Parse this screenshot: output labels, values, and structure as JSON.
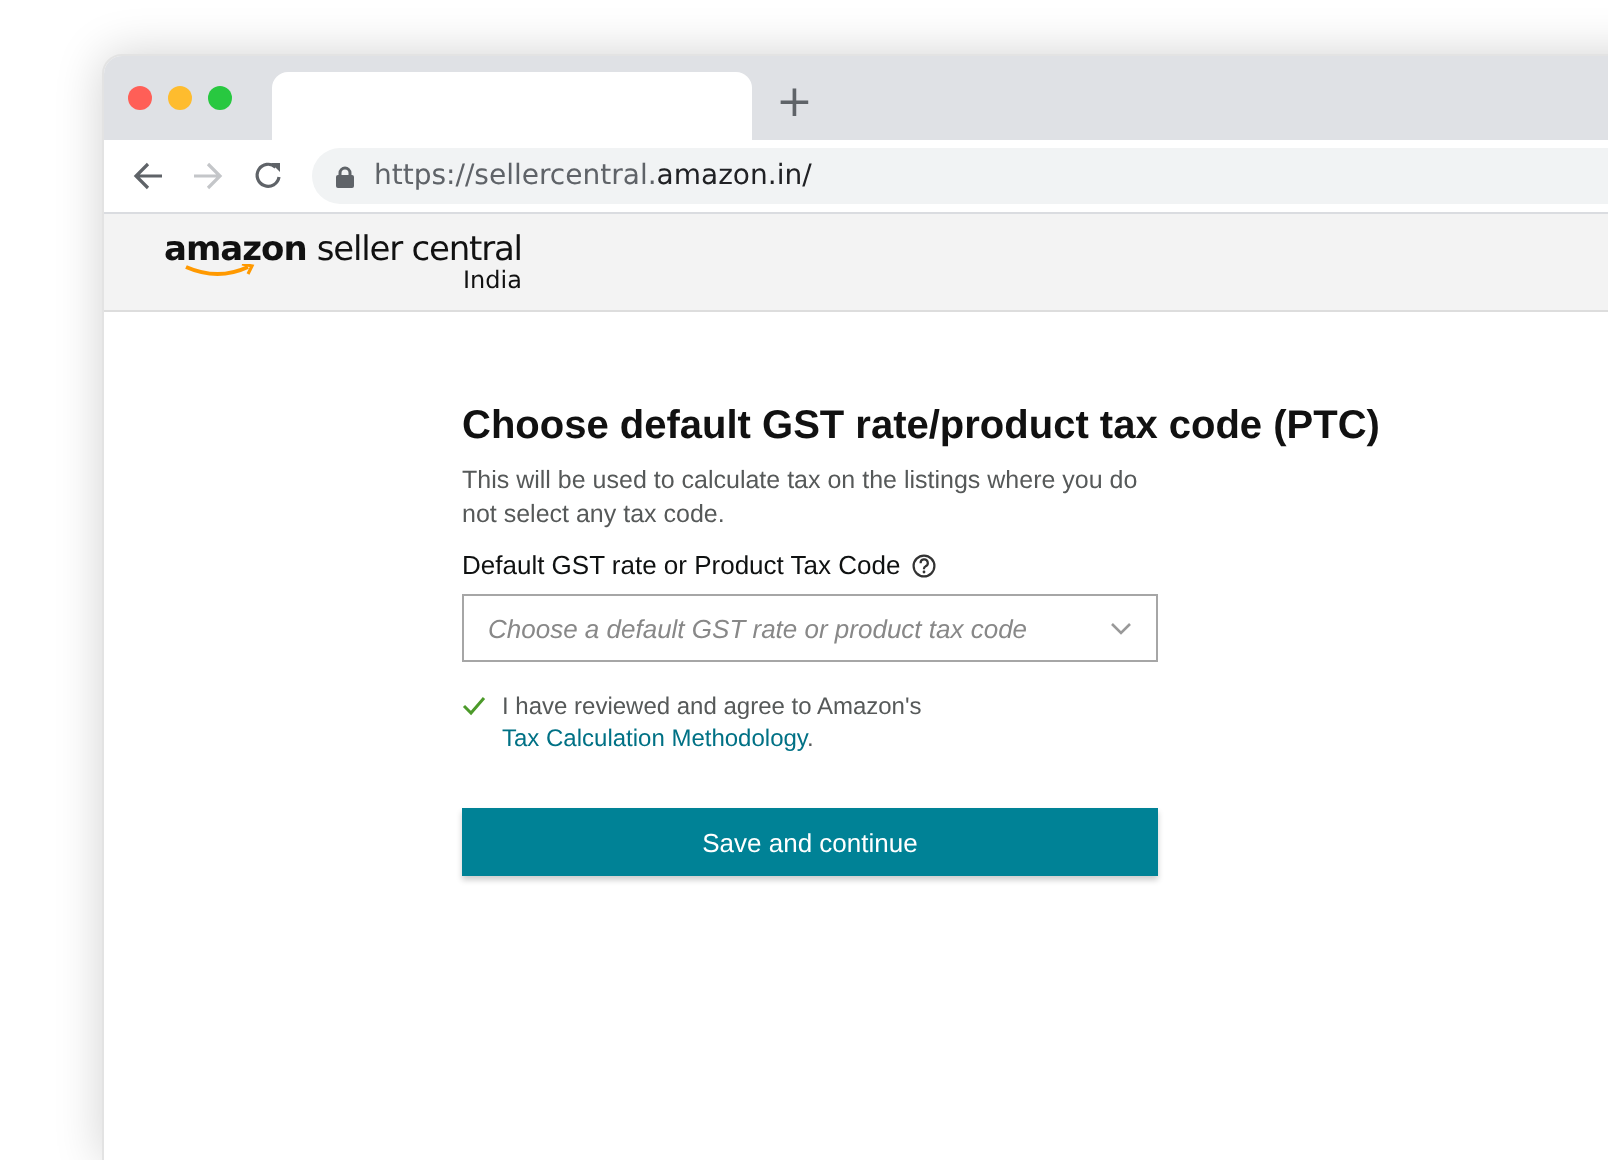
{
  "browser": {
    "url": {
      "prefix": "https://sellercentral.",
      "host": "amazon.in/"
    },
    "new_tab": "+"
  },
  "header": {
    "logo": {
      "brand": "amazon",
      "product": "seller central",
      "region": "India"
    }
  },
  "form": {
    "title": "Choose default GST rate/product tax code (PTC)",
    "description": "This will be used to calculate tax on the listings where you do not select any tax code.",
    "field_label": "Default GST rate or Product Tax Code",
    "select": {
      "placeholder": "Choose a default GST rate or product tax code"
    },
    "agreement": {
      "checked": true,
      "text": "I have reviewed and agree to Amazon's ",
      "link": "Tax Calculation Methodology",
      "end": "."
    },
    "submit": "Save and continue"
  }
}
